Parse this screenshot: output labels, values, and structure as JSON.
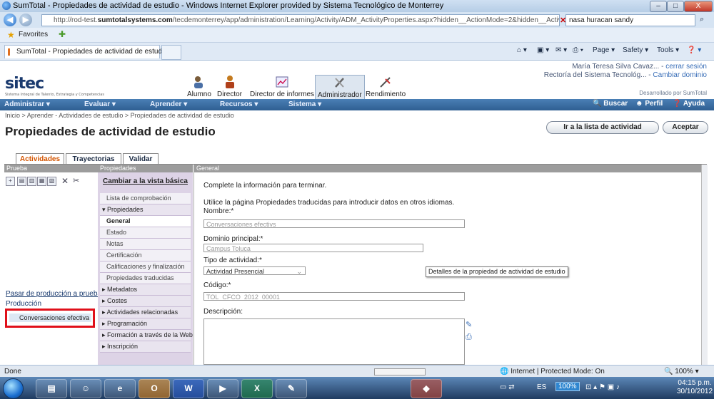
{
  "window": {
    "title": "SumTotal - Propiedades de actividad de estudio - Windows Internet Explorer provided by Sistema Tecnológico de Monterrey",
    "controls": [
      "–",
      "□",
      "X"
    ]
  },
  "browser": {
    "url_prefix": "http://rod-test.",
    "url_domain": "sumtotalsystems.com",
    "url_rest": "/tecdemonterrey/app/administration/Learning/Activity/ADM_ActivityProperties.aspx?hidden__ActionMode=2&hidden__Activ",
    "search_text": "nasa huracan sandy",
    "favorites_label": "Favorites",
    "tab_title": "SumTotal - Propiedades de actividad de estudio",
    "command_items": [
      "Page ▾",
      "Safety ▾",
      "Tools ▾"
    ]
  },
  "app": {
    "logo_text": "sitec",
    "logo_subtitle": "Sistema Integral de Talento, Estrategia y Competencias",
    "roles": [
      {
        "label": "Alumno"
      },
      {
        "label": "Director"
      },
      {
        "label": "Director de informes"
      },
      {
        "label": "Administrador"
      },
      {
        "label": "Rendimiento"
      }
    ],
    "user_name": "María Teresa Silva Cavaz...",
    "logout": "cerrar sesión",
    "org": "Rectoría del Sistema Tecnológ...",
    "change_domain": "Cambiar dominio",
    "developed_by": "Desarrollado por SumTotal"
  },
  "menubar": {
    "items": [
      "Administrar ▾",
      "Evaluar ▾",
      "Aprender ▾",
      "Recursos ▾",
      "Sistema ▾"
    ],
    "right": [
      "Buscar",
      "Perfil",
      "Ayuda"
    ]
  },
  "page": {
    "breadcrumb": "Inicio > Aprender - Actividades de estudio > Propiedades de actividad de estudio",
    "title": "Propiedades de actividad de estudio",
    "btn_list": "Ir a la lista de actividad",
    "btn_accept": "Aceptar",
    "tabs": [
      "Actividades",
      "Trayectorias",
      "Validar"
    ]
  },
  "left_panel": {
    "header": "Prueba",
    "promote_link": "Pasar de producción a prueba",
    "production_label": "Producción",
    "selected_item": "Conversaciones efectiva"
  },
  "mid_panel": {
    "header": "Propiedades",
    "view_link": "Cambiar a la vista básica",
    "items": [
      {
        "label": "Lista de comprobación",
        "kind": "item"
      },
      {
        "label": "▾ Propiedades",
        "kind": "sec"
      },
      {
        "label": "General",
        "kind": "cur"
      },
      {
        "label": "Estado",
        "kind": "item"
      },
      {
        "label": "Notas",
        "kind": "item"
      },
      {
        "label": "Certificación",
        "kind": "item"
      },
      {
        "label": "Calificaciones y finalización",
        "kind": "item"
      },
      {
        "label": "Propiedades traducidas",
        "kind": "item"
      },
      {
        "label": "▸ Metadatos",
        "kind": "sec"
      },
      {
        "label": "▸ Costes",
        "kind": "sec"
      },
      {
        "label": "▸ Actividades relacionadas",
        "kind": "sec"
      },
      {
        "label": "▸ Programación",
        "kind": "sec"
      },
      {
        "label": "▸ Formación a través de la Web",
        "kind": "sec"
      },
      {
        "label": "▸ Inscripción",
        "kind": "sec"
      }
    ]
  },
  "form": {
    "header": "General",
    "intro": "Complete la información para terminar.",
    "translated_note": "Utilice la página Propiedades traducidas para introducir datos en otros idiomas.",
    "name_label": "Nombre:*",
    "name_value": "Conversaciones efectivs",
    "domain_label": "Dominio principal:*",
    "domain_value": "Campus Toluca",
    "type_label": "Tipo de actividad:*",
    "type_value": "Actividad Presencial",
    "code_label": "Código:*",
    "code_value": "TOL_CFCO_2012_00001",
    "desc_label": "Descripción:",
    "tooltip": "Detalles de la propiedad de actividad de estudio"
  },
  "status": {
    "left": "Done",
    "zone": "Internet | Protected Mode: On",
    "zoom": "100%"
  },
  "taskbar": {
    "lang": "ES",
    "percent": "100%",
    "time": "04:15 p.m.",
    "date": "30/10/2012"
  }
}
